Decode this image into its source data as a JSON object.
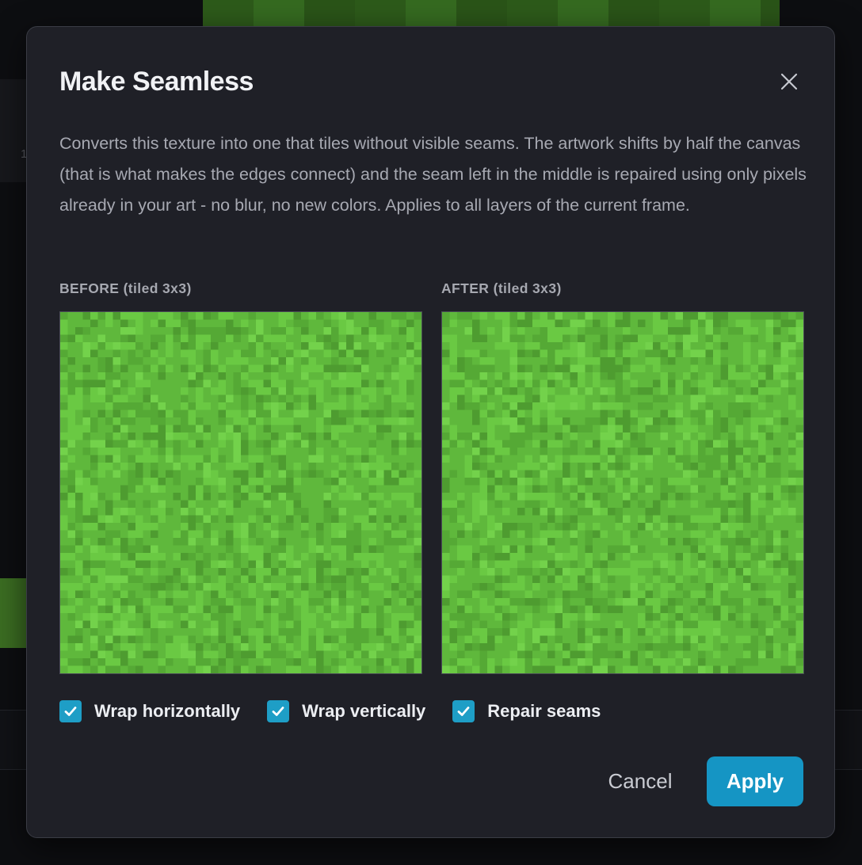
{
  "dialog": {
    "title": "Make Seamless",
    "description": "Converts this texture into one that tiles without visible seams. The artwork shifts by half the canvas (that is what makes the edges connect) and the seam left in the middle is repaired using only pixels already in your art - no blur, no new colors. Applies to all layers of the current frame."
  },
  "previews": {
    "before_label": "BEFORE (tiled 3x3)",
    "after_label": "AFTER (tiled 3x3)",
    "tiling": "3x3",
    "palette": [
      "#5fb83c",
      "#6ac943",
      "#55a935",
      "#4e9c30",
      "#73d24b"
    ]
  },
  "options": [
    {
      "label": "Wrap horizontally",
      "checked": true
    },
    {
      "label": "Wrap vertically",
      "checked": true
    },
    {
      "label": "Repair seams",
      "checked": true
    }
  ],
  "buttons": {
    "cancel": "Cancel",
    "apply": "Apply"
  },
  "background": {
    "left_panel_digit": "1"
  },
  "colors": {
    "accent": "#1595c4",
    "checkbox": "#1e9ec6",
    "dialog_bg": "#1f2027"
  }
}
